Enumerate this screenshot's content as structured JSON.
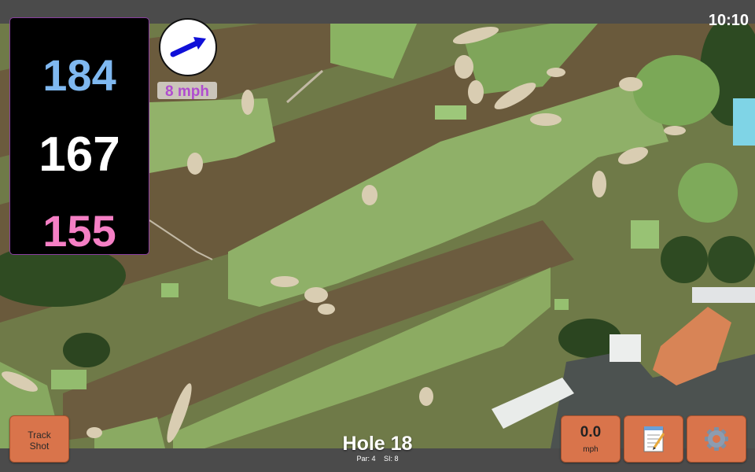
{
  "status_bar": {
    "time": "10:10"
  },
  "yardages": {
    "back": "184",
    "middle": "167",
    "front": "155"
  },
  "wind": {
    "speed_label": "8 mph",
    "direction_icon": "arrow-icon"
  },
  "buttons": {
    "track_shot_line1": "Track",
    "track_shot_line2": "Shot",
    "speed_value": "0.0",
    "speed_unit": "mph",
    "notes_icon": "notepad-icon",
    "settings_icon": "gear-icon"
  },
  "hole": {
    "title": "Hole 18",
    "par": "Par: 4",
    "si": "SI: 8"
  },
  "colors": {
    "back_yardage": "#7fb8f0",
    "middle_yardage": "#ffffff",
    "front_yardage": "#f57fc5",
    "button_orange": "#d9744b",
    "wind_text": "#b04ccf"
  }
}
